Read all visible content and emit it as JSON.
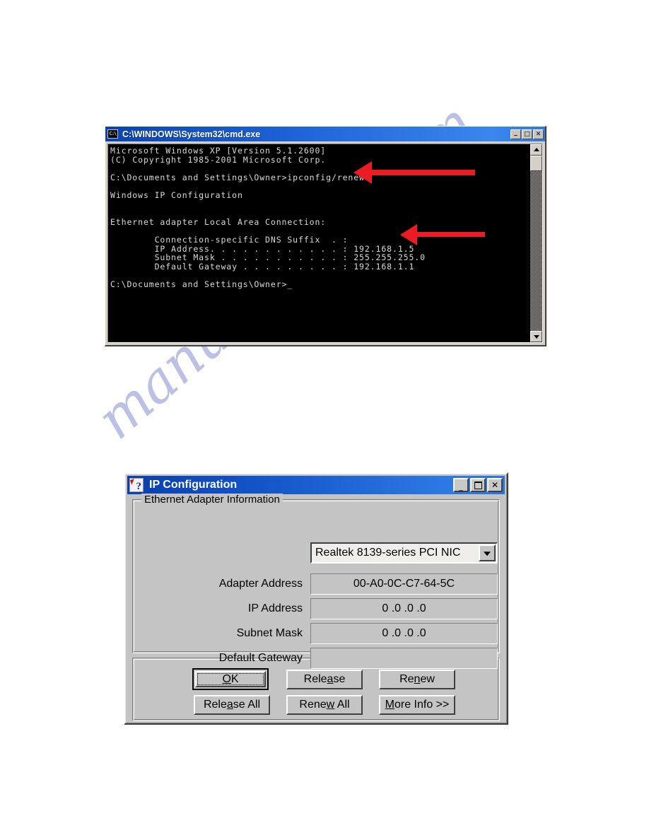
{
  "watermark": {
    "text": "manualshive.com"
  },
  "cmd_window": {
    "title": "C:\\WINDOWS\\System32\\cmd.exe",
    "icon": "cmd-console-icon",
    "icon_text": "C:\\",
    "titlebar_buttons": [
      {
        "name": "minimize",
        "glyph": "_"
      },
      {
        "name": "maximize",
        "glyph": "□"
      },
      {
        "name": "close",
        "glyph": "✕"
      }
    ],
    "console_text": "Microsoft Windows XP [Version 5.1.2600]\n(C) Copyright 1985-2001 Microsoft Corp.\n\nC:\\Documents and Settings\\Owner>ipconfig/renew\n\nWindows IP Configuration\n\n\nEthernet adapter Local Area Connection:\n\n        Connection-specific DNS Suffix  . :\n        IP Address. . . . . . . . . . . . : 192.168.1.5\n        Subnet Mask . . . . . . . . . . . : 255.255.255.0\n        Default Gateway . . . . . . . . . : 192.168.1.1\n\nC:\\Documents and Settings\\Owner>_",
    "scrollbar": {
      "up_arrow": "scroll-up-arrow",
      "down_arrow": "scroll-down-arrow"
    },
    "annotations": [
      {
        "name": "arrow-ipconfig-renew",
        "points_to": "ipconfig/renew",
        "color": "#ed1c24"
      },
      {
        "name": "arrow-ip-address",
        "points_to": "192.168.1.5",
        "color": "#ed1c24"
      }
    ]
  },
  "ipconfig_dialog": {
    "title": "IP Configuration",
    "icon": "help-arrow-icon",
    "titlebar_buttons": [
      {
        "name": "minimize",
        "glyph": "_"
      },
      {
        "name": "maximize",
        "glyph": ""
      },
      {
        "name": "close",
        "glyph": "✕"
      }
    ],
    "group_ethernet_legend": "Ethernet  Adapter Information",
    "adapter_combo": {
      "value": "Realtek 8139-series PCI NIC",
      "arrow": "chevron-down-icon"
    },
    "fields": [
      {
        "label": "Adapter Address",
        "value": "00-A0-0C-C7-64-5C"
      },
      {
        "label": "IP Address",
        "value": "0 .0 .0 .0"
      },
      {
        "label": "Subnet Mask",
        "value": "0 .0 .0 .0"
      },
      {
        "label": "Default Gateway",
        "value": ""
      }
    ],
    "buttons": [
      {
        "name": "ok",
        "pre": "",
        "acc": "O",
        "post": "K",
        "default": true
      },
      {
        "name": "release",
        "pre": "Rele",
        "acc": "a",
        "post": "se",
        "default": false
      },
      {
        "name": "renew",
        "pre": "Re",
        "acc": "n",
        "post": "ew",
        "default": false
      },
      {
        "name": "release-all",
        "pre": "Rele",
        "acc": "a",
        "post": "se All",
        "default": false
      },
      {
        "name": "renew-all",
        "pre": "Rene",
        "acc": "w",
        "post": " All",
        "default": false
      },
      {
        "name": "more-info",
        "pre": "",
        "acc": "M",
        "post": "ore Info >>",
        "default": false
      }
    ]
  }
}
